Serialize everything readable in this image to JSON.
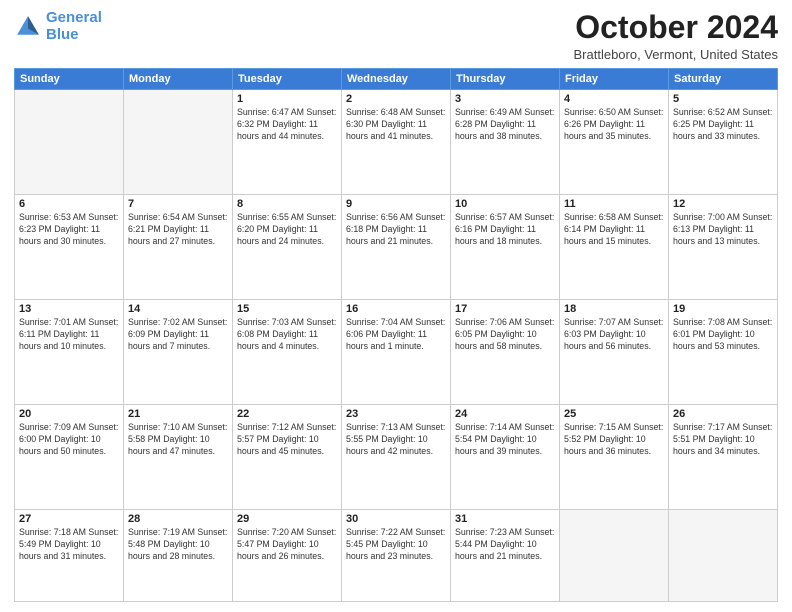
{
  "header": {
    "logo_line1": "General",
    "logo_line2": "Blue",
    "month": "October 2024",
    "location": "Brattleboro, Vermont, United States"
  },
  "weekdays": [
    "Sunday",
    "Monday",
    "Tuesday",
    "Wednesday",
    "Thursday",
    "Friday",
    "Saturday"
  ],
  "weeks": [
    [
      {
        "day": "",
        "info": ""
      },
      {
        "day": "",
        "info": ""
      },
      {
        "day": "1",
        "info": "Sunrise: 6:47 AM\nSunset: 6:32 PM\nDaylight: 11 hours and 44 minutes."
      },
      {
        "day": "2",
        "info": "Sunrise: 6:48 AM\nSunset: 6:30 PM\nDaylight: 11 hours and 41 minutes."
      },
      {
        "day": "3",
        "info": "Sunrise: 6:49 AM\nSunset: 6:28 PM\nDaylight: 11 hours and 38 minutes."
      },
      {
        "day": "4",
        "info": "Sunrise: 6:50 AM\nSunset: 6:26 PM\nDaylight: 11 hours and 35 minutes."
      },
      {
        "day": "5",
        "info": "Sunrise: 6:52 AM\nSunset: 6:25 PM\nDaylight: 11 hours and 33 minutes."
      }
    ],
    [
      {
        "day": "6",
        "info": "Sunrise: 6:53 AM\nSunset: 6:23 PM\nDaylight: 11 hours and 30 minutes."
      },
      {
        "day": "7",
        "info": "Sunrise: 6:54 AM\nSunset: 6:21 PM\nDaylight: 11 hours and 27 minutes."
      },
      {
        "day": "8",
        "info": "Sunrise: 6:55 AM\nSunset: 6:20 PM\nDaylight: 11 hours and 24 minutes."
      },
      {
        "day": "9",
        "info": "Sunrise: 6:56 AM\nSunset: 6:18 PM\nDaylight: 11 hours and 21 minutes."
      },
      {
        "day": "10",
        "info": "Sunrise: 6:57 AM\nSunset: 6:16 PM\nDaylight: 11 hours and 18 minutes."
      },
      {
        "day": "11",
        "info": "Sunrise: 6:58 AM\nSunset: 6:14 PM\nDaylight: 11 hours and 15 minutes."
      },
      {
        "day": "12",
        "info": "Sunrise: 7:00 AM\nSunset: 6:13 PM\nDaylight: 11 hours and 13 minutes."
      }
    ],
    [
      {
        "day": "13",
        "info": "Sunrise: 7:01 AM\nSunset: 6:11 PM\nDaylight: 11 hours and 10 minutes."
      },
      {
        "day": "14",
        "info": "Sunrise: 7:02 AM\nSunset: 6:09 PM\nDaylight: 11 hours and 7 minutes."
      },
      {
        "day": "15",
        "info": "Sunrise: 7:03 AM\nSunset: 6:08 PM\nDaylight: 11 hours and 4 minutes."
      },
      {
        "day": "16",
        "info": "Sunrise: 7:04 AM\nSunset: 6:06 PM\nDaylight: 11 hours and 1 minute."
      },
      {
        "day": "17",
        "info": "Sunrise: 7:06 AM\nSunset: 6:05 PM\nDaylight: 10 hours and 58 minutes."
      },
      {
        "day": "18",
        "info": "Sunrise: 7:07 AM\nSunset: 6:03 PM\nDaylight: 10 hours and 56 minutes."
      },
      {
        "day": "19",
        "info": "Sunrise: 7:08 AM\nSunset: 6:01 PM\nDaylight: 10 hours and 53 minutes."
      }
    ],
    [
      {
        "day": "20",
        "info": "Sunrise: 7:09 AM\nSunset: 6:00 PM\nDaylight: 10 hours and 50 minutes."
      },
      {
        "day": "21",
        "info": "Sunrise: 7:10 AM\nSunset: 5:58 PM\nDaylight: 10 hours and 47 minutes."
      },
      {
        "day": "22",
        "info": "Sunrise: 7:12 AM\nSunset: 5:57 PM\nDaylight: 10 hours and 45 minutes."
      },
      {
        "day": "23",
        "info": "Sunrise: 7:13 AM\nSunset: 5:55 PM\nDaylight: 10 hours and 42 minutes."
      },
      {
        "day": "24",
        "info": "Sunrise: 7:14 AM\nSunset: 5:54 PM\nDaylight: 10 hours and 39 minutes."
      },
      {
        "day": "25",
        "info": "Sunrise: 7:15 AM\nSunset: 5:52 PM\nDaylight: 10 hours and 36 minutes."
      },
      {
        "day": "26",
        "info": "Sunrise: 7:17 AM\nSunset: 5:51 PM\nDaylight: 10 hours and 34 minutes."
      }
    ],
    [
      {
        "day": "27",
        "info": "Sunrise: 7:18 AM\nSunset: 5:49 PM\nDaylight: 10 hours and 31 minutes."
      },
      {
        "day": "28",
        "info": "Sunrise: 7:19 AM\nSunset: 5:48 PM\nDaylight: 10 hours and 28 minutes."
      },
      {
        "day": "29",
        "info": "Sunrise: 7:20 AM\nSunset: 5:47 PM\nDaylight: 10 hours and 26 minutes."
      },
      {
        "day": "30",
        "info": "Sunrise: 7:22 AM\nSunset: 5:45 PM\nDaylight: 10 hours and 23 minutes."
      },
      {
        "day": "31",
        "info": "Sunrise: 7:23 AM\nSunset: 5:44 PM\nDaylight: 10 hours and 21 minutes."
      },
      {
        "day": "",
        "info": ""
      },
      {
        "day": "",
        "info": ""
      }
    ]
  ]
}
